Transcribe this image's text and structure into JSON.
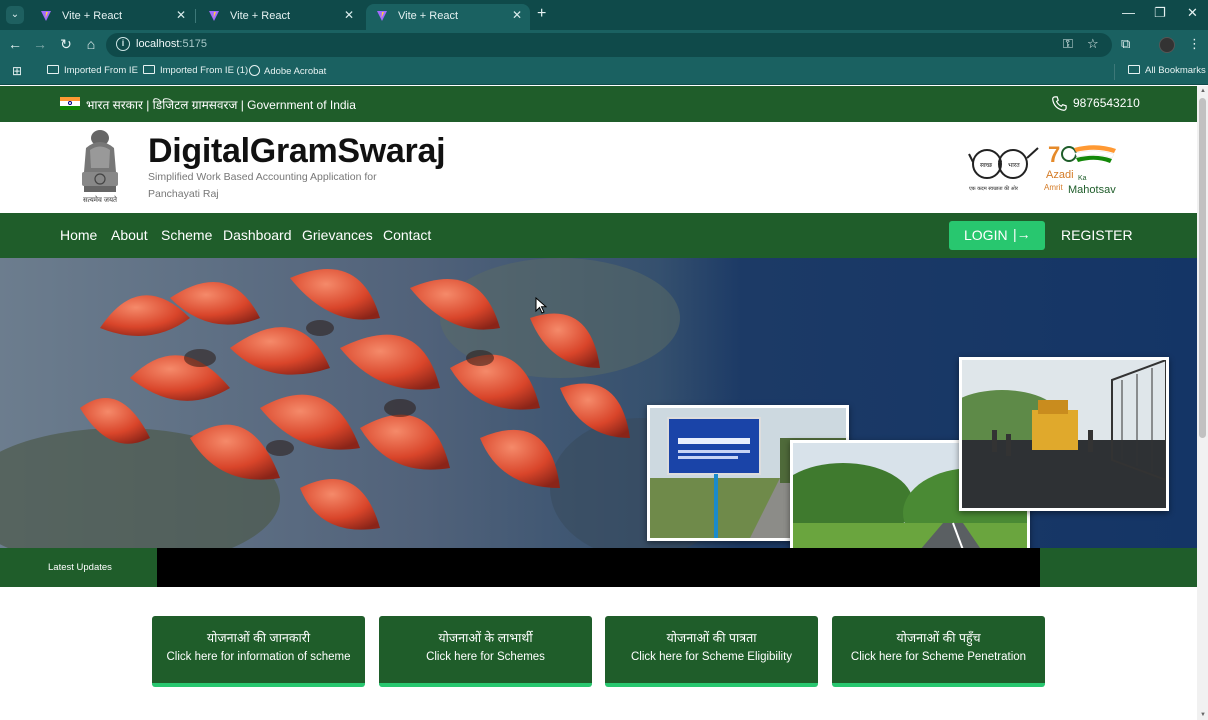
{
  "browser": {
    "tabs": [
      {
        "title": "Vite + React",
        "active": false
      },
      {
        "title": "Vite + React",
        "active": false
      },
      {
        "title": "Vite + React",
        "active": true
      }
    ],
    "url_host": "localhost",
    "url_port": ":5175",
    "bookmarks": [
      {
        "label": "Imported From IE",
        "icon": "folder-icon"
      },
      {
        "label": "Imported From IE (1)",
        "icon": "folder-icon"
      },
      {
        "label": "Adobe Acrobat",
        "icon": "globe-icon"
      }
    ],
    "all_bookmarks": "All Bookmarks"
  },
  "gov_strip": {
    "text": "भारत सरकार | डिजिटल ग्रामसवरज | Government of India",
    "phone": "9876543210"
  },
  "header": {
    "brand": "DigitalGramSwaraj",
    "tagline": "Simplified Work Based Accounting Application for Panchayati Raj",
    "emblem_caption": "सत्यमेव जयते"
  },
  "nav": {
    "items": [
      "Home",
      "About",
      "Scheme",
      "Dashboard",
      "Grievances",
      "Contact"
    ],
    "login": "LOGIN",
    "login_arrow": "|→",
    "register": "REGISTER"
  },
  "updates": {
    "label": "Latest Updates"
  },
  "cards": [
    {
      "hindi": "योजनाओं की जानकारी",
      "english": "Click here for information of scheme"
    },
    {
      "hindi": "योजनाओं के लाभार्थी",
      "english": "Click here for Schemes"
    },
    {
      "hindi": "योजनाओं की पात्रता",
      "english": "Click here for Scheme Eligibility"
    },
    {
      "hindi": "योजनाओं की पहुँच",
      "english": "Click here for Scheme Penetration"
    }
  ],
  "colors": {
    "primary_green": "#1f5d2a",
    "accent_green": "#28c76f",
    "chrome_teal": "#1a6161"
  }
}
